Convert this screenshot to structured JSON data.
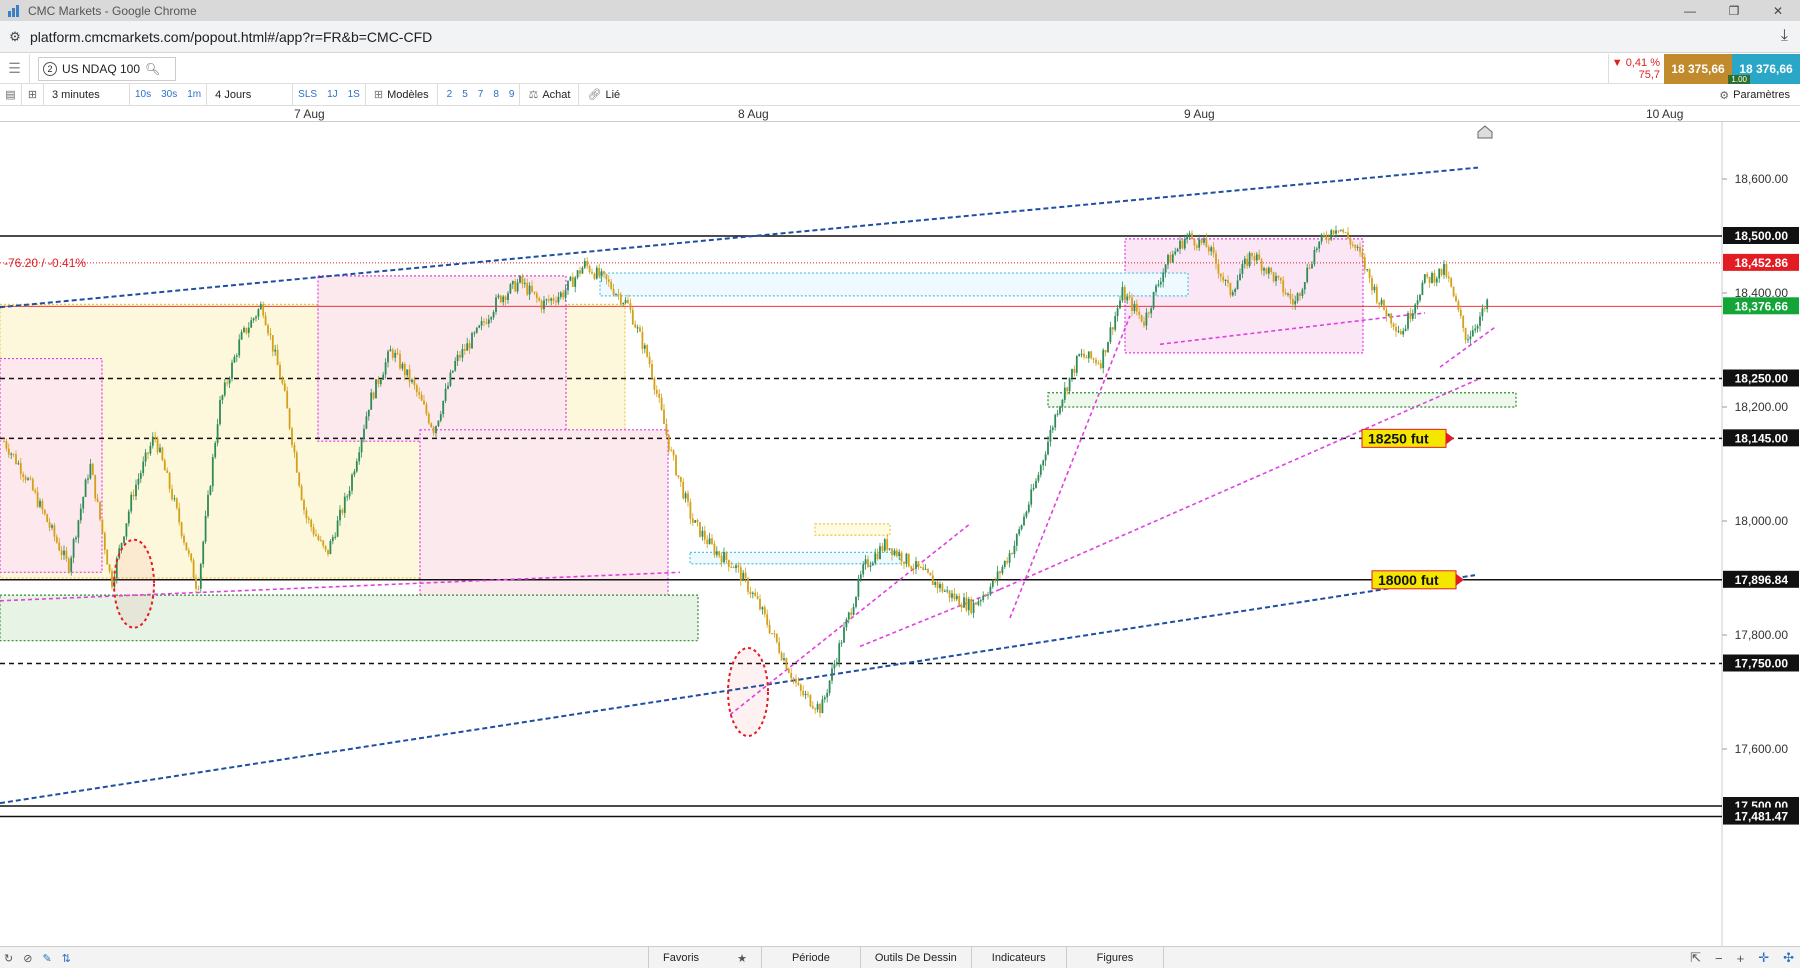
{
  "window": {
    "title": "CMC Markets - Google Chrome",
    "url": "platform.cmcmarkets.com/popout.html#/app?r=FR&b=CMC-CFD"
  },
  "instrument": {
    "index": "2",
    "name": "US NDAQ 100",
    "change_pct": "▼ 0,41 %",
    "change_abs": "75,7",
    "sell": "18 375,66",
    "buy": "18 376,66",
    "spread": "1.00"
  },
  "toolbar": {
    "interval": "3 minutes",
    "intervals": [
      "10s",
      "30s",
      "1m"
    ],
    "range": "4 Jours",
    "ranges": [
      "SLS",
      "1J",
      "1S"
    ],
    "templates": "Modèles",
    "counts": [
      "2",
      "5",
      "7",
      "8",
      "9"
    ],
    "buy": "Achat",
    "linked": "Lié",
    "settings": "Paramètres"
  },
  "dates": [
    "7 Aug",
    "8 Aug",
    "9 Aug",
    "10 Aug"
  ],
  "bottom": {
    "tabs": [
      "Favoris",
      "Période",
      "Outils De Dessin",
      "Indicateurs",
      "Figures"
    ]
  },
  "colors": {
    "up": "#2e8b57",
    "down": "#d4a017",
    "current": "#13a538",
    "prev_close": "#e31b23",
    "trend_blue": "#1e4fa3",
    "trend_pink": "#e040e0",
    "flag_yellow": "#f5e600"
  },
  "chart_data": {
    "type": "candlestick",
    "symbol": "US NDAQ 100",
    "timeframe": "3 minutes",
    "y_ticks": [
      17600,
      17800,
      18000,
      18200,
      18400,
      18600
    ],
    "ylim": [
      17480,
      18700
    ],
    "y_tick_labels": [
      "17,600.00",
      "17,800.00",
      "18,000.00",
      "18,200.00",
      "18,400.00",
      "18,600.00"
    ],
    "x_labels": [
      "7 Aug",
      "8 Aug",
      "9 Aug",
      "10 Aug"
    ],
    "horizontal_lines": [
      {
        "value": 18500,
        "label": "18,500.00",
        "style": "solid"
      },
      {
        "value": 18250,
        "label": "18,250.00",
        "style": "dashed"
      },
      {
        "value": 18145,
        "label": "18,145.00",
        "style": "dashed"
      },
      {
        "value": 17896.84,
        "label": "17,896.84",
        "style": "solid"
      },
      {
        "value": 17750,
        "label": "17,750.00",
        "style": "dashed"
      },
      {
        "value": 17500,
        "label": "17,500.00",
        "style": "solid"
      },
      {
        "value": 17481.47,
        "label": "17,481.47",
        "style": "solid"
      }
    ],
    "prev_close": {
      "value": 18452.86,
      "label": "18,452.86",
      "annotation": "-76.20 / -0.41%"
    },
    "current": {
      "value": 18376.66,
      "label": "18,376.66"
    },
    "flags": [
      {
        "value": 18145,
        "text": "18250 fut"
      },
      {
        "value": 17896.84,
        "text": "18000 fut"
      }
    ],
    "series": [
      {
        "day": "7 Aug",
        "points": [
          18140,
          18080,
          18000,
          17920,
          18100,
          17890,
          18050,
          18150,
          18020,
          17880,
          18200,
          18320,
          18380,
          18230,
          18010,
          17940,
          18050,
          18210,
          18300,
          18240,
          18160,
          18280,
          18330,
          18390,
          18420,
          18380,
          18400,
          18450
        ]
      },
      {
        "day": "8 Aug",
        "points": [
          18420,
          18380,
          18280,
          18120,
          18000,
          17950,
          17920,
          17860,
          17780,
          17700,
          17670,
          17800,
          17920,
          17960,
          17930,
          17900,
          17870,
          17850,
          17890,
          17960,
          18070,
          18200,
          18290
        ]
      },
      {
        "day": "9 Aug",
        "points": [
          18280,
          18400,
          18350,
          18450,
          18500,
          18480,
          18400,
          18470,
          18430,
          18380,
          18480,
          18520,
          18470,
          18380,
          18330,
          18420,
          18440,
          18320,
          18380
        ]
      }
    ]
  }
}
